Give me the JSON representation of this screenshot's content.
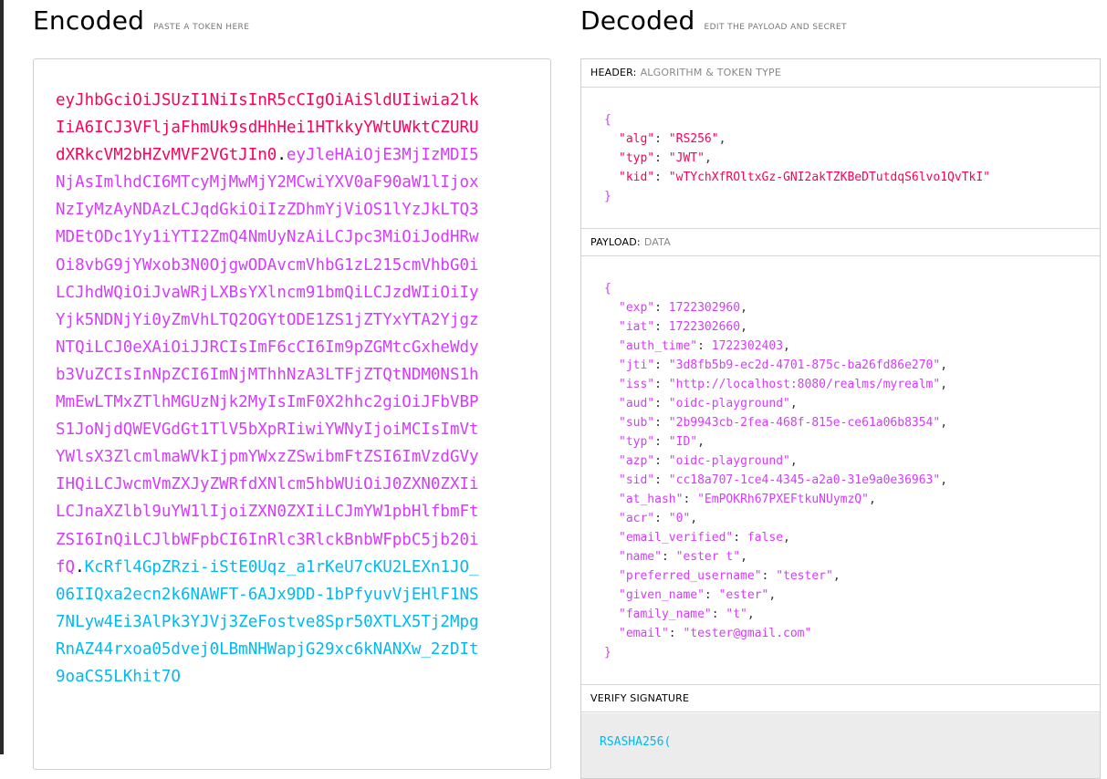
{
  "encoded": {
    "title": "Encoded",
    "subtitle": "PASTE A TOKEN HERE",
    "header_part": "eyJhbGciOiJSUzI1NiIsInR5cCIgOiAiSldUIiwia2lkIiA6ICJ3VFljaFhmUk9sdHhHei1HTkkyYWtUWktCZURUdXRkcVM2bHZvMVF2VGtJIn0",
    "payload_part": "eyJleHAiOjE3MjIzMDI5NjAsImlhdCI6MTcyMjMwMjY2MCwiYXV0aF90aW1lIjoxNzIyMzAyNDAzLCJqdGkiOiIzZDhmYjViOS1lYzJkLTQ3MDEtODc1Yy1iYTI2ZmQ4NmUyNzAiLCJpc3MiOiJodHRwOi8vbG9jYWxob3N0OjgwODAvcmVhbG1zL215cmVhbG0iLCJhdWQiOiJvaWRjLXBsYXlncm91bmQiLCJzdWIiOiIyYjk5NDNjYi0yZmVhLTQ2OGYtODE1ZS1jZTYxYTA2YjgzNTQiLCJ0eXAiOiJJRCIsImF6cCI6Im9pZGMtcGxheWdyb3VuZCIsInNpZCI6ImNjMThhNzA3LTFjZTQtNDM0NS1hMmEwLTMxZTlhMGUzNjk2MyIsImF0X2hhc2giOiJFbVBPS1JoNjdQWEVGdGt1TlV5bXpRIiwiYWNyIjoiMCIsImVtYWlsX3ZlcmlmaWVkIjpmYWxzZSwibmFtZSI6ImVzdGVyIHQiLCJwcmVmZXJyZWRfdXNlcm5hbWUiOiJ0ZXN0ZXIiLCJnaXZlbl9uYW1lIjoiZXN0ZXIiLCJmYW1pbHlfbmFtZSI6InQiLCJlbWFpbCI6InRlc3RlckBnbWFpbC5jb20ifQ",
    "signature_part": "KcRfl4GpZRzi-iStE0Uqz_a1rKeU7cKU2LEXn1JO_06IIQxa2ecn2k6NAWFT-6AJx9DD-1bPfyuvVjEHlF1NS7NLyw4Ei3AlPk3YJVj3ZeFostve8Spr50XTLX5Tj2MpgRnAZ44rxoa05dvej0LBmNHWapjG29xc6kNANXw_2zDIt9oaCS5LKhit7O",
    "dot": "."
  },
  "decoded": {
    "title": "Decoded",
    "subtitle": "EDIT THE PAYLOAD AND SECRET",
    "header_section": {
      "label": "HEADER:",
      "desc": "ALGORITHM & TOKEN TYPE",
      "fields": [
        {
          "key": "\"alg\"",
          "value": "\"RS256\"",
          "comma": ","
        },
        {
          "key": "\"typ\"",
          "value": "\"JWT\"",
          "comma": ","
        },
        {
          "key": "\"kid\"",
          "value": "\"wTYchXfROltxGz-GNI2akTZKBeDTutdqS6lvo1QvTkI\"",
          "comma": ""
        }
      ]
    },
    "payload_section": {
      "label": "PAYLOAD:",
      "desc": "DATA",
      "fields": [
        {
          "key": "\"exp\"",
          "value": "1722302960",
          "comma": ","
        },
        {
          "key": "\"iat\"",
          "value": "1722302660",
          "comma": ","
        },
        {
          "key": "\"auth_time\"",
          "value": "1722302403",
          "comma": ","
        },
        {
          "key": "\"jti\"",
          "value": "\"3d8fb5b9-ec2d-4701-875c-ba26fd86e270\"",
          "comma": ","
        },
        {
          "key": "\"iss\"",
          "value": "\"http://localhost:8080/realms/myrealm\"",
          "comma": ","
        },
        {
          "key": "\"aud\"",
          "value": "\"oidc-playground\"",
          "comma": ","
        },
        {
          "key": "\"sub\"",
          "value": "\"2b9943cb-2fea-468f-815e-ce61a06b8354\"",
          "comma": ","
        },
        {
          "key": "\"typ\"",
          "value": "\"ID\"",
          "comma": ","
        },
        {
          "key": "\"azp\"",
          "value": "\"oidc-playground\"",
          "comma": ","
        },
        {
          "key": "\"sid\"",
          "value": "\"cc18a707-1ce4-4345-a2a0-31e9a0e36963\"",
          "comma": ","
        },
        {
          "key": "\"at_hash\"",
          "value": "\"EmPOKRh67PXEFtkuNUymzQ\"",
          "comma": ","
        },
        {
          "key": "\"acr\"",
          "value": "\"0\"",
          "comma": ","
        },
        {
          "key": "\"email_verified\"",
          "value": "false",
          "comma": ","
        },
        {
          "key": "\"name\"",
          "value": "\"ester t\"",
          "comma": ","
        },
        {
          "key": "\"preferred_username\"",
          "value": "\"tester\"",
          "comma": ","
        },
        {
          "key": "\"given_name\"",
          "value": "\"ester\"",
          "comma": ","
        },
        {
          "key": "\"family_name\"",
          "value": "\"t\"",
          "comma": ","
        },
        {
          "key": "\"email\"",
          "value": "\"tester@gmail.com\"",
          "comma": ""
        }
      ]
    },
    "open_brace": "{",
    "close_brace": "}",
    "colon": ": ",
    "verify_section": {
      "label": "VERIFY SIGNATURE",
      "algo_line": "RSASHA256("
    }
  },
  "colors": {
    "header": "#fb015b",
    "payload": "#d63aff",
    "signature": "#00b9f1"
  }
}
